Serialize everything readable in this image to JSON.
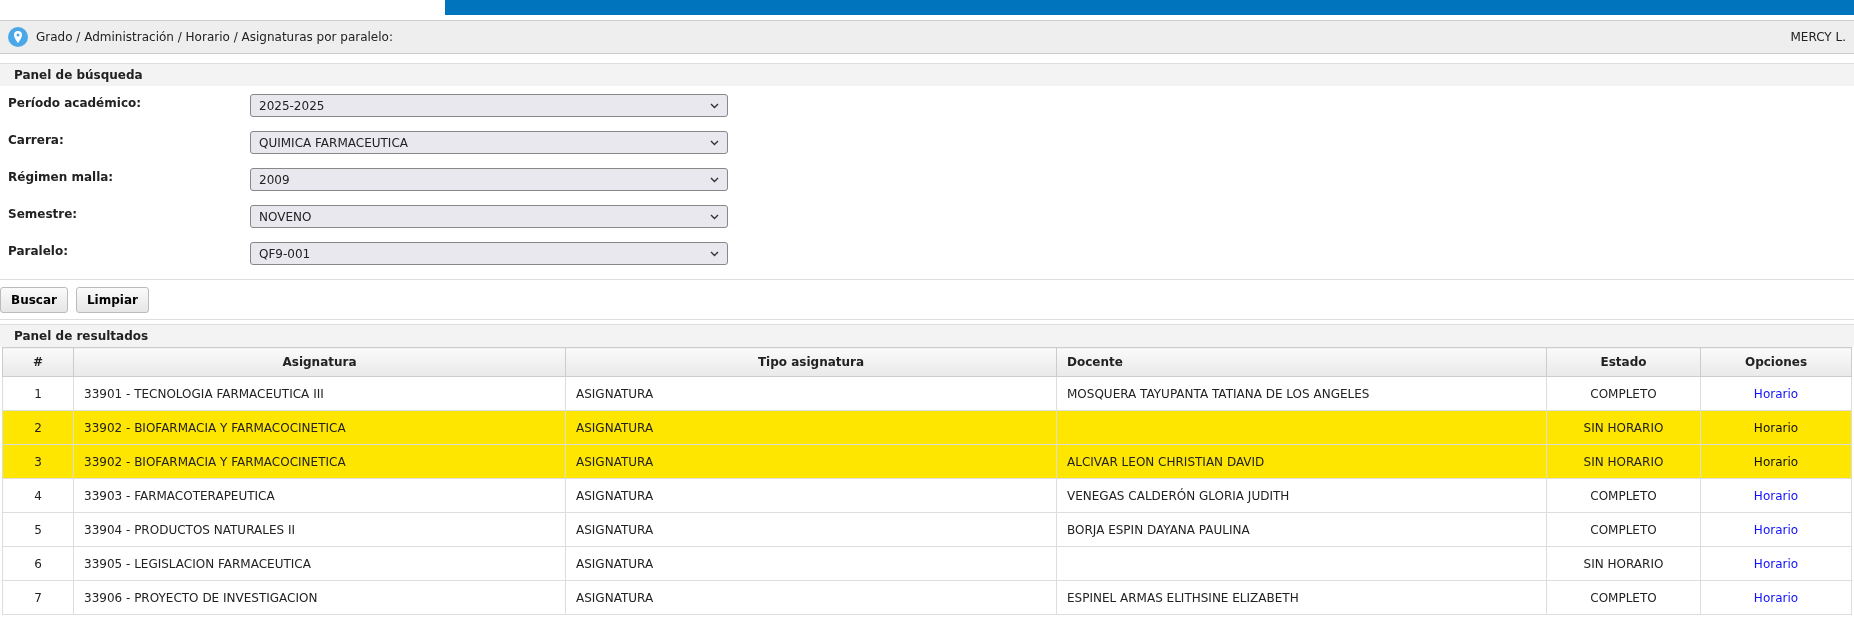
{
  "breadcrumb": {
    "text": "Grado / Administración / Horario / Asignaturas por paralelo:",
    "user": "MERCY L."
  },
  "search_panel": {
    "title": "Panel de búsqueda",
    "fields": [
      {
        "label": "Período académico:",
        "value": "2025-2025"
      },
      {
        "label": "Carrera:",
        "value": "QUIMICA FARMACEUTICA"
      },
      {
        "label": "Régimen malla:",
        "value": "2009"
      },
      {
        "label": "Semestre:",
        "value": "NOVENO"
      },
      {
        "label": "Paralelo:",
        "value": "QF9-001"
      }
    ]
  },
  "buttons": [
    "Buscar",
    "Limpiar"
  ],
  "results_panel": {
    "title": "Panel de resultados",
    "columns": [
      "#",
      "Asignatura",
      "Tipo asignatura",
      "Docente",
      "Estado",
      "Opciones"
    ],
    "rows": [
      {
        "num": "1",
        "asignatura": "33901 - TECNOLOGIA FARMACEUTICA III",
        "tipo": "ASIGNATURA",
        "docente": "MOSQUERA TAYUPANTA TATIANA DE LOS ANGELES",
        "estado": "COMPLETO",
        "opcion": "Horario",
        "highlighted": false
      },
      {
        "num": "2",
        "asignatura": "33902 - BIOFARMACIA Y FARMACOCINETICA",
        "tipo": "ASIGNATURA",
        "docente": "",
        "estado": "SIN HORARIO",
        "opcion": "Horario",
        "highlighted": true
      },
      {
        "num": "3",
        "asignatura": "33902 - BIOFARMACIA Y FARMACOCINETICA",
        "tipo": "ASIGNATURA",
        "docente": "ALCIVAR LEON CHRISTIAN DAVID",
        "estado": "SIN HORARIO",
        "opcion": "Horario",
        "highlighted": true
      },
      {
        "num": "4",
        "asignatura": "33903 - FARMACOTERAPEUTICA",
        "tipo": "ASIGNATURA",
        "docente": "VENEGAS CALDERÓN GLORIA JUDITH",
        "estado": "COMPLETO",
        "opcion": "Horario",
        "highlighted": false
      },
      {
        "num": "5",
        "asignatura": "33904 - PRODUCTOS NATURALES II",
        "tipo": "ASIGNATURA",
        "docente": "BORJA ESPIN DAYANA PAULINA",
        "estado": "COMPLETO",
        "opcion": "Horario",
        "highlighted": false
      },
      {
        "num": "6",
        "asignatura": "33905 - LEGISLACION FARMACEUTICA",
        "tipo": "ASIGNATURA",
        "docente": "",
        "estado": "SIN HORARIO",
        "opcion": "Horario",
        "highlighted": false
      },
      {
        "num": "7",
        "asignatura": "33906 - PROYECTO DE INVESTIGACION",
        "tipo": "ASIGNATURA",
        "docente": "ESPINEL ARMAS ELITHSINE ELIZABETH",
        "estado": "COMPLETO",
        "opcion": "Horario",
        "highlighted": false
      }
    ]
  }
}
